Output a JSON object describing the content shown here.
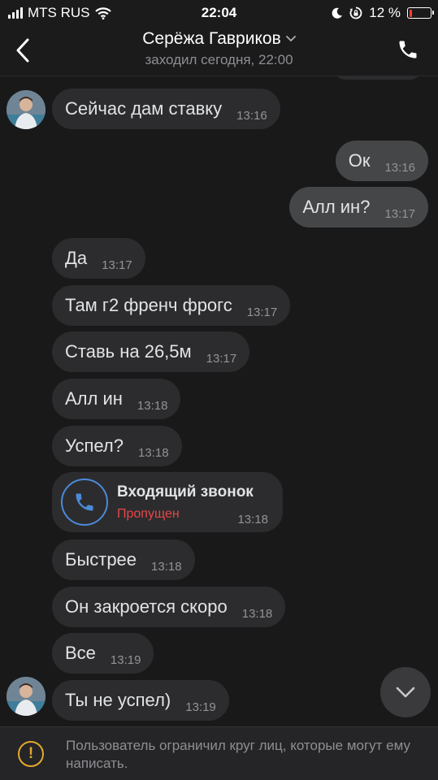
{
  "status_bar": {
    "carrier": "MTS RUS",
    "time": "22:04",
    "battery_percent_label": "12 %",
    "battery_level": 0.12,
    "battery_color": "#ff3b30"
  },
  "header": {
    "title": "Серёжа Гавриков",
    "subtitle": "заходил сегодня, 22:00",
    "back_icon": "chevron-left-icon",
    "call_icon": "phone-icon",
    "title_dropdown_icon": "chevron-down-icon"
  },
  "messages": [
    {
      "direction": "in",
      "text": "Сейчас дам ставку",
      "time": "13:16",
      "avatar": true
    },
    {
      "direction": "out",
      "text": "Ок",
      "time": "13:16"
    },
    {
      "direction": "out",
      "text": "Алл ин?",
      "time": "13:17"
    },
    {
      "direction": "in",
      "text": "Да",
      "time": "13:17"
    },
    {
      "direction": "in",
      "text": "Там г2 френч фрогс",
      "time": "13:17"
    },
    {
      "direction": "in",
      "text": "Ставь на 26,5м",
      "time": "13:17"
    },
    {
      "direction": "in",
      "text": "Алл ин",
      "time": "13:18"
    },
    {
      "direction": "in",
      "text": "Успел?",
      "time": "13:18"
    },
    {
      "direction": "in",
      "type": "call",
      "title": "Входящий звонок",
      "status": "Пропущен",
      "time": "13:18"
    },
    {
      "direction": "in",
      "text": "Быстрее",
      "time": "13:18"
    },
    {
      "direction": "in",
      "text": "Он закроется скоро",
      "time": "13:18"
    },
    {
      "direction": "in",
      "text": "Все",
      "time": "13:19"
    },
    {
      "direction": "in",
      "text": "Ты не успел)",
      "time": "13:19",
      "avatar": true
    }
  ],
  "notice": {
    "icon": "warning-icon",
    "icon_glyph": "!",
    "text": "Пользователь ограничил круг лиц, которые могут ему написать."
  },
  "colors": {
    "background": "#19191a",
    "incoming_bubble": "#2c2c2e",
    "outgoing_bubble": "#454647",
    "missed_call": "#e64646",
    "call_accent": "#4a8ad8",
    "warning": "#e4a82d"
  }
}
